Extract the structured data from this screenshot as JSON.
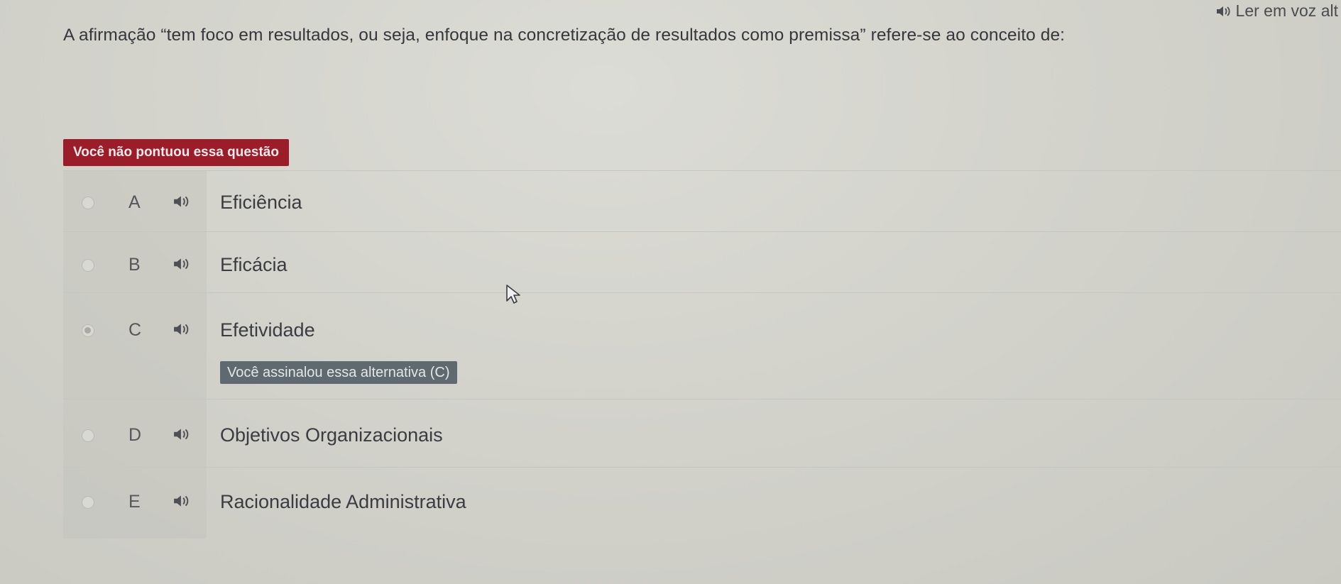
{
  "header": {
    "read_aloud_label": "Ler em voz alt"
  },
  "question": {
    "text": "A afirmação “tem foco em resultados, ou seja, enfoque na concretização de resultados como premissa” refere-se ao conceito de:"
  },
  "feedback": {
    "score_message": "Você não pontuou essa questão",
    "selected_message": "Você assinalou essa alternativa (C)"
  },
  "options": [
    {
      "letter": "A",
      "text": "Eficiência",
      "selected": false
    },
    {
      "letter": "B",
      "text": "Eficácia",
      "selected": false
    },
    {
      "letter": "C",
      "text": "Efetividade",
      "selected": true
    },
    {
      "letter": "D",
      "text": "Objetivos Organizacionais",
      "selected": false
    },
    {
      "letter": "E",
      "text": "Racionalidade Administrativa",
      "selected": false
    }
  ],
  "icons": {
    "speaker": "speaker-icon",
    "cursor": "mouse-pointer-icon"
  },
  "colors": {
    "score_badge": "#9b1d2a",
    "answer_badge": "#5f6a70"
  }
}
